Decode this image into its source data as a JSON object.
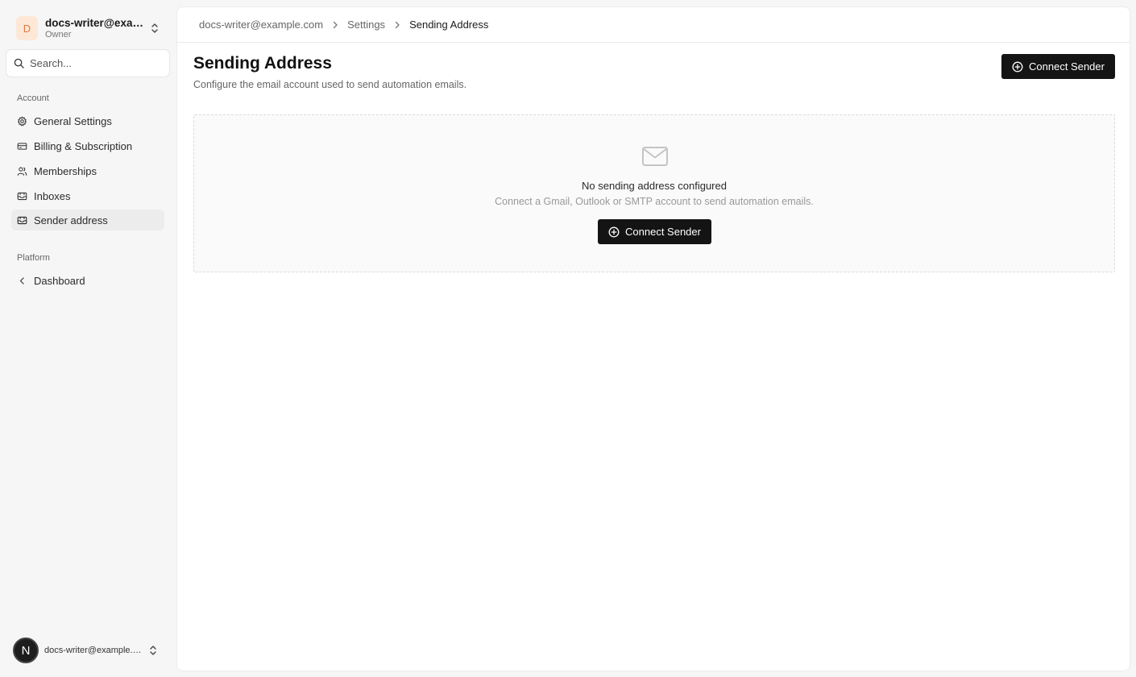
{
  "org": {
    "initial": "D",
    "name": "docs-writer@example.com",
    "role": "Owner"
  },
  "search": {
    "placeholder": "Search..."
  },
  "sidebar": {
    "account_label": "Account",
    "account_items": [
      {
        "label": "General Settings",
        "icon": "gear-icon"
      },
      {
        "label": "Billing & Subscription",
        "icon": "credit-card-icon"
      },
      {
        "label": "Memberships",
        "icon": "users-icon"
      },
      {
        "label": "Inboxes",
        "icon": "inbox-icon"
      },
      {
        "label": "Sender address",
        "icon": "inbox-icon",
        "active": true
      }
    ],
    "platform_label": "Platform",
    "platform_items": [
      {
        "label": "Dashboard",
        "icon": "chevron-left-icon"
      }
    ]
  },
  "user": {
    "initial": "N",
    "email": "docs-writer@example.com"
  },
  "breadcrumb": [
    "docs-writer@example.com",
    "Settings",
    "Sending Address"
  ],
  "header": {
    "title": "Sending Address",
    "subtitle": "Configure the email account used to send automation emails.",
    "connect_label": "Connect Sender"
  },
  "empty_state": {
    "icon": "mail-icon",
    "title": "No sending address configured",
    "description": "Connect a Gmail, Outlook or SMTP account to send automation emails.",
    "button_label": "Connect Sender"
  },
  "colors": {
    "accent": "#141414",
    "avatar_bg": "#fde8d8",
    "avatar_fg": "#e8793b"
  }
}
